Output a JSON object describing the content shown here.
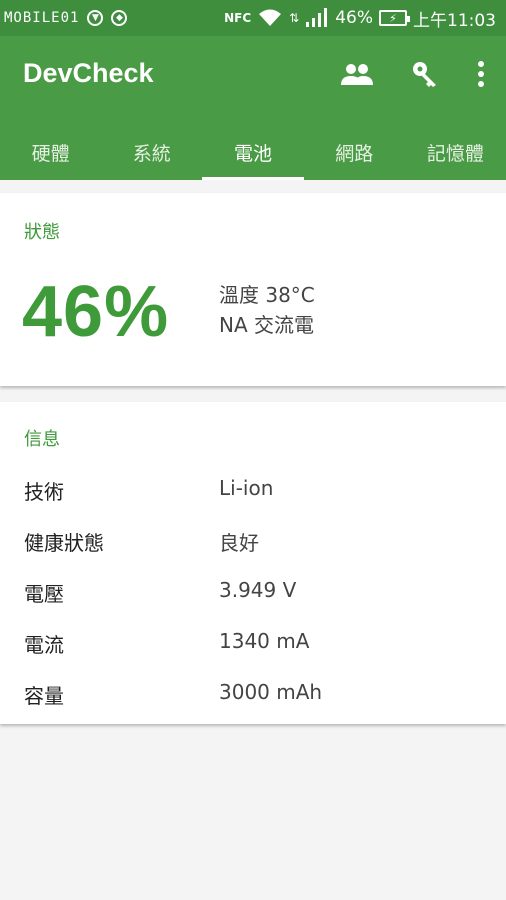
{
  "status_bar": {
    "watermark": "MOBILE01",
    "nfc": "NFC",
    "battery_percent": "46%",
    "time": "上午11:03"
  },
  "app_bar": {
    "title": "DevCheck",
    "actions": [
      "people-icon",
      "key-icon",
      "more-vert-icon"
    ]
  },
  "tabs": [
    {
      "label": "硬體",
      "active": false
    },
    {
      "label": "系統",
      "active": false
    },
    {
      "label": "電池",
      "active": true
    },
    {
      "label": "網路",
      "active": false
    },
    {
      "label": "記憶體",
      "active": false
    }
  ],
  "status_card": {
    "header": "狀態",
    "percent": "46%",
    "temperature": "溫度 38°C",
    "power": "NA 交流電"
  },
  "info_card": {
    "header": "信息",
    "rows": [
      {
        "label": "技術",
        "value": "Li-ion"
      },
      {
        "label": "健康狀態",
        "value": "良好"
      },
      {
        "label": "電壓",
        "value": "3.949 V"
      },
      {
        "label": "電流",
        "value": "1340 mA"
      },
      {
        "label": "容量",
        "value": "3000 mAh"
      }
    ]
  },
  "colors": {
    "status_bar": "#3e8e3e",
    "app_bar": "#4a9b45",
    "accent": "#3f9a3a"
  }
}
